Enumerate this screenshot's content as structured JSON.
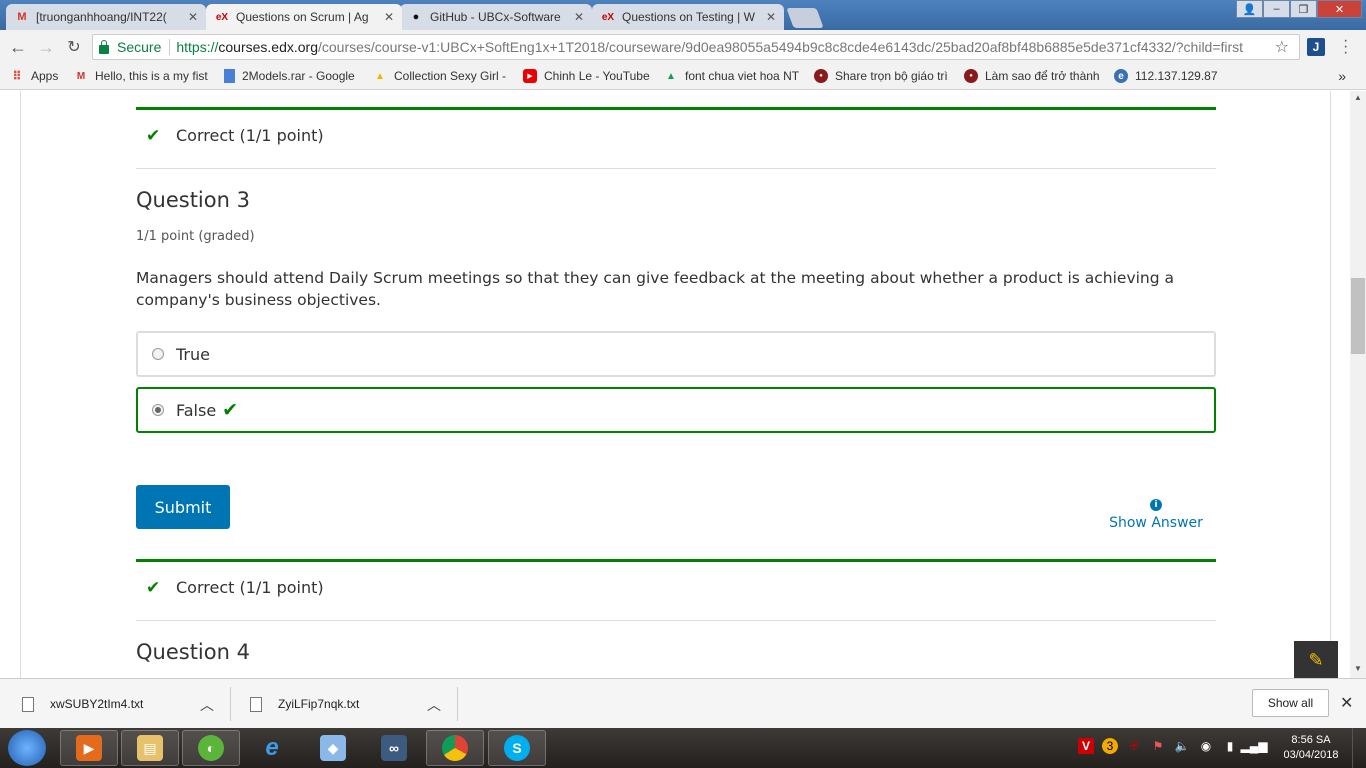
{
  "tabs": [
    {
      "title": "[truonganhhoang/INT22(",
      "icon": "gmail-icon"
    },
    {
      "title": "Questions on Scrum | Ag",
      "icon": "edx-icon"
    },
    {
      "title": "GitHub - UBCx-Software",
      "icon": "github-icon"
    },
    {
      "title": "Questions on Testing | W",
      "icon": "edx-icon"
    }
  ],
  "address": {
    "secure_label": "Secure",
    "scheme": "https://",
    "host": "courses.edx.org",
    "path": "/courses/course-v1:UBCx+SoftEng1x+1T2018/courseware/9d0ea98055a5494b9c8c8cde4e6143dc/25bad20af8bf48b6885e5de371cf4332/?child=first"
  },
  "bookmarks": [
    {
      "label": "Apps",
      "icon": "apps-grid-icon"
    },
    {
      "label": "Hello, this is a my fist",
      "icon": "gmail-icon"
    },
    {
      "label": "2Models.rar - Google",
      "icon": "doc-icon"
    },
    {
      "label": "Collection Sexy Girl -",
      "icon": "drive-icon"
    },
    {
      "label": "Chinh Le - YouTube",
      "icon": "youtube-icon"
    },
    {
      "label": "font chua viet hoa NT",
      "icon": "drive-icon"
    },
    {
      "label": "Share trọn bộ giáo trì",
      "icon": "forum-icon"
    },
    {
      "label": "Làm sao để trở thành",
      "icon": "forum-icon"
    },
    {
      "label": "112.137.129.87",
      "icon": "globe-icon"
    }
  ],
  "content": {
    "result_top": "Correct (1/1 point)",
    "question3": {
      "title": "Question 3",
      "points": "1/1 point (graded)",
      "text": "Managers should attend Daily Scrum meetings so that they can give feedback at the meeting about whether a product is achieving a company's business objectives.",
      "options": [
        {
          "label": "True",
          "selected": false
        },
        {
          "label": "False",
          "selected": true
        }
      ]
    },
    "submit_label": "Submit",
    "show_answer_label": "Show Answer",
    "result_bottom": "Correct (1/1 point)",
    "question4_title": "Question 4"
  },
  "downloads": [
    {
      "filename": "xwSUBY2tIm4.txt"
    },
    {
      "filename": "ZyiLFip7nqk.txt"
    }
  ],
  "show_all_label": "Show all",
  "taskbar": {
    "time": "8:56 SA",
    "date": "03/04/2018"
  },
  "colors": {
    "correct_green": "#008100",
    "edx_blue": "#0075b4"
  }
}
